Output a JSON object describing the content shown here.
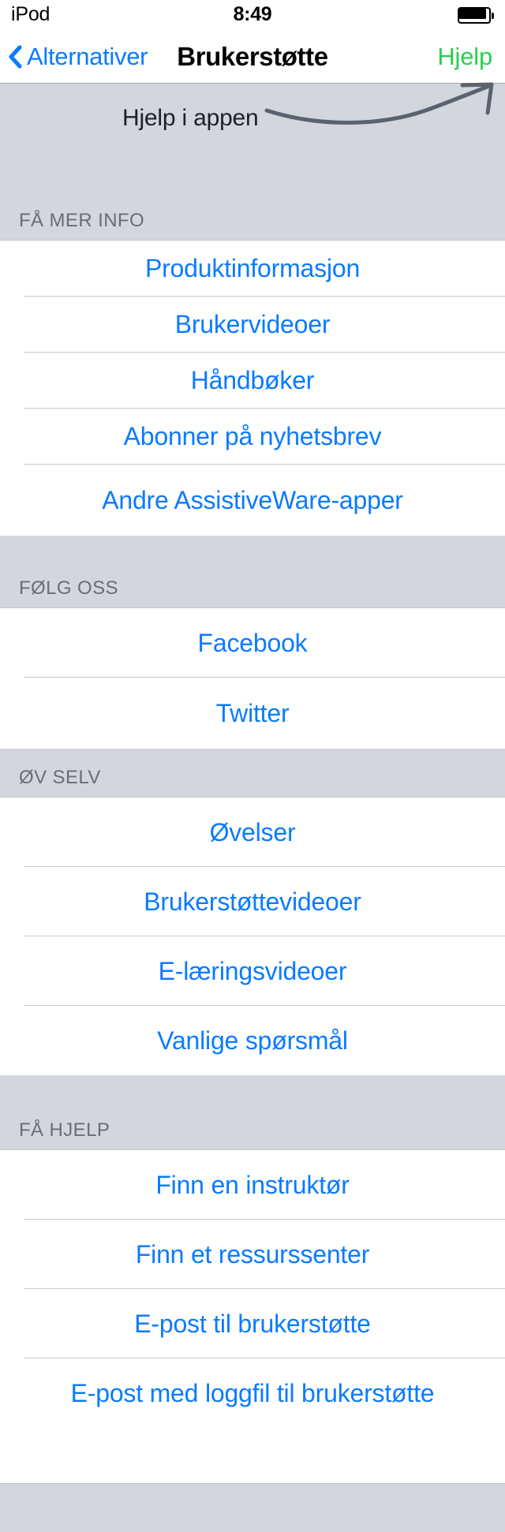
{
  "statusbar": {
    "carrier": "iPod",
    "time": "8:49",
    "battery_icon": "battery-full-icon"
  },
  "navbar": {
    "back_label": "Alternativer",
    "back_icon": "chevron-left-icon",
    "title": "Brukerstøtte",
    "action_label": "Hjelp",
    "action_color": "#29cf4d",
    "tint_color": "#0b7bff"
  },
  "annotation": {
    "text": "Hjelp i appen",
    "arrow_icon": "curved-arrow-up-right-icon",
    "background": "#d3d6dd"
  },
  "sections": [
    {
      "header": "FÅ MER INFO",
      "items": [
        {
          "label": "Produktinformasjon"
        },
        {
          "label": "Brukervideoer"
        },
        {
          "label": "Håndbøker"
        },
        {
          "label": "Abonner på nyhetsbrev"
        },
        {
          "label": "Andre AssistiveWare-apper"
        }
      ]
    },
    {
      "header": "FØLG OSS",
      "items": [
        {
          "label": "Facebook"
        },
        {
          "label": "Twitter"
        }
      ]
    },
    {
      "header": "ØV SELV",
      "items": [
        {
          "label": "Øvelser"
        },
        {
          "label": "Brukerstøttevideoer"
        },
        {
          "label": "E-læringsvideoer"
        },
        {
          "label": "Vanlige spørsmål"
        }
      ]
    },
    {
      "header": "FÅ HJELP",
      "items": [
        {
          "label": "Finn en instruktør"
        },
        {
          "label": "Finn et ressurssenter"
        },
        {
          "label": "E-post til brukerstøtte"
        },
        {
          "label": "E-post med loggfil til brukerstøtte"
        }
      ]
    }
  ]
}
